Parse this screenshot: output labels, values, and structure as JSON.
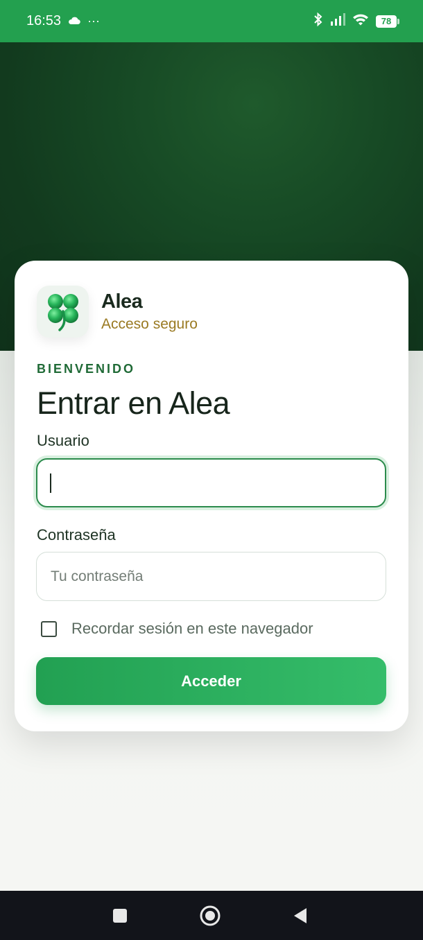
{
  "status_bar": {
    "time": "16:53",
    "overflow": "···",
    "battery": "78",
    "icons": [
      "cloud-icon",
      "bluetooth-icon",
      "signal-icon",
      "wifi-icon",
      "battery-icon"
    ]
  },
  "brand": {
    "name": "Alea",
    "tagline": "Acceso seguro",
    "logo": "four-leaf-clover-icon"
  },
  "form": {
    "eyebrow": "BIENVENIDO",
    "title": "Entrar en Alea",
    "username": {
      "label": "Usuario",
      "value": "",
      "placeholder": ""
    },
    "password": {
      "label": "Contraseña",
      "value": "",
      "placeholder": "Tu contraseña"
    },
    "remember": {
      "label": "Recordar sesión en este navegador",
      "checked": false
    },
    "submit_label": "Acceder"
  },
  "navigation": [
    "square-icon",
    "home-circle-icon",
    "back-triangle-icon"
  ],
  "colors": {
    "status_bar": "#23a04f",
    "hero": "#174a25",
    "accent": "#2b8b4c",
    "tagline": "#9a7a22",
    "button": "#2aac5b"
  }
}
